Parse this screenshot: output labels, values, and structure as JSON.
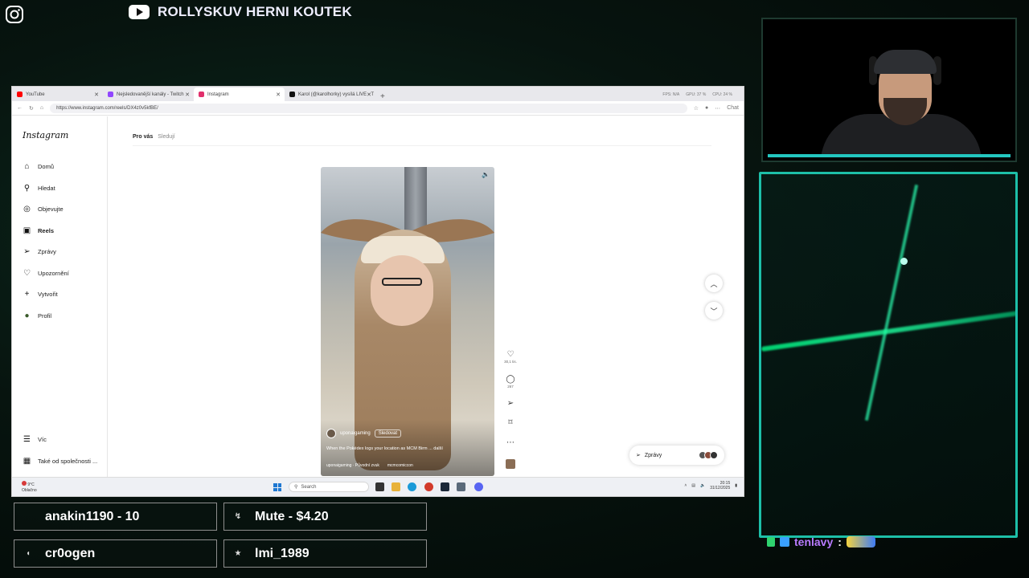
{
  "overlay": {
    "channel_name": "ROLLYSKUV HERNI KOUTEK",
    "instagram_icon": "instagram-icon",
    "youtube_icon": "youtube-icon"
  },
  "browser": {
    "tabs": [
      {
        "label": "YouTube",
        "color": "#ff0000"
      },
      {
        "label": "Nejsledovanější kanály - Twitch",
        "color": "#9146ff"
      },
      {
        "label": "Instagram",
        "color": "#e1306c",
        "active": true
      },
      {
        "label": "Karol (@karolhorky) vysílá LIVE - T",
        "color": "#111111"
      }
    ],
    "stats": {
      "fps": "FPS: N/A",
      "gpu": "GPU: 37 %",
      "cpu": "CPU: 24 %"
    },
    "url": "https://www.instagram.com/reels/DX4z0v5kfBE/",
    "chat_label": "Chat"
  },
  "instagram": {
    "logo": "Instagram",
    "nav": [
      {
        "label": "Domů",
        "icon": "home-icon",
        "glyph": "⌂"
      },
      {
        "label": "Hledat",
        "icon": "search-icon",
        "glyph": "⚲"
      },
      {
        "label": "Objevujte",
        "icon": "compass-icon",
        "glyph": "◎"
      },
      {
        "label": "Reels",
        "icon": "reels-icon",
        "glyph": "▣"
      },
      {
        "label": "Zprávy",
        "icon": "send-icon",
        "glyph": "➢"
      },
      {
        "label": "Upozornění",
        "icon": "heart-icon",
        "glyph": "♡"
      },
      {
        "label": "Vytvořit",
        "icon": "plus-icon",
        "glyph": "+"
      },
      {
        "label": "Profil",
        "icon": "profile-icon",
        "glyph": "●"
      }
    ],
    "more": "Víc",
    "meta": "Také od společnosti ...",
    "feed_tabs": {
      "for_you": "Pro vás",
      "following": "Sledují"
    },
    "reel": {
      "author": "uponaigaming",
      "follow": "Sledovat",
      "caption": "When the Pokédex logs your location as MCM Birm ... další",
      "audio": "uponaigaming · Původní zvuk",
      "location": "mcmcomiccon"
    },
    "actions": {
      "likes": "30,1 tis.",
      "comments": "267"
    },
    "messages_label": "Zprávy"
  },
  "taskbar": {
    "temp": "9°C",
    "weather": "Oblačno",
    "search": "Search",
    "time": "20:15",
    "date": "31/12/2025"
  },
  "events": [
    {
      "text": "anakin1190 - 10",
      "icon": "follow-icon",
      "glyph": "↳"
    },
    {
      "text": "Mute - $4.20",
      "icon": "donation-icon",
      "glyph": "↯"
    },
    {
      "text": "cr0ogen",
      "icon": "sub-icon",
      "glyph": "■"
    },
    {
      "text": "lmi_1989",
      "icon": "star-icon",
      "glyph": "★"
    }
  ],
  "chat": {
    "user": "tenlavy",
    "separator": ":"
  },
  "colors": {
    "accent": "#1dbfa8",
    "instagram": "#e1306c"
  }
}
